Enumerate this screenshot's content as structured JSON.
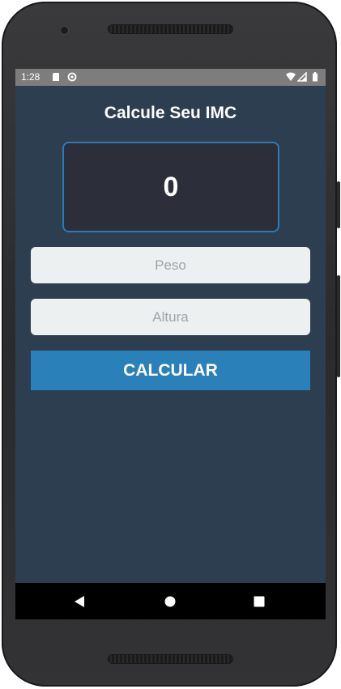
{
  "status_bar": {
    "time": "1:28",
    "icons": [
      "sd-card-icon",
      "sync-icon",
      "wifi-icon",
      "signal-icon",
      "battery-icon"
    ]
  },
  "app": {
    "title": "Calcule Seu IMC",
    "result": "0",
    "inputs": {
      "peso_placeholder": "Peso",
      "altura_placeholder": "Altura"
    },
    "button_label": "CALCULAR"
  },
  "nav_bar": {
    "icons": [
      "back-icon",
      "home-icon",
      "recents-icon"
    ]
  },
  "colors": {
    "background": "#2c3e50",
    "accent": "#2a80b9",
    "input_bg": "#ecf0f1",
    "result_bg": "#2c2f3a",
    "result_border": "#2a7ab8"
  }
}
